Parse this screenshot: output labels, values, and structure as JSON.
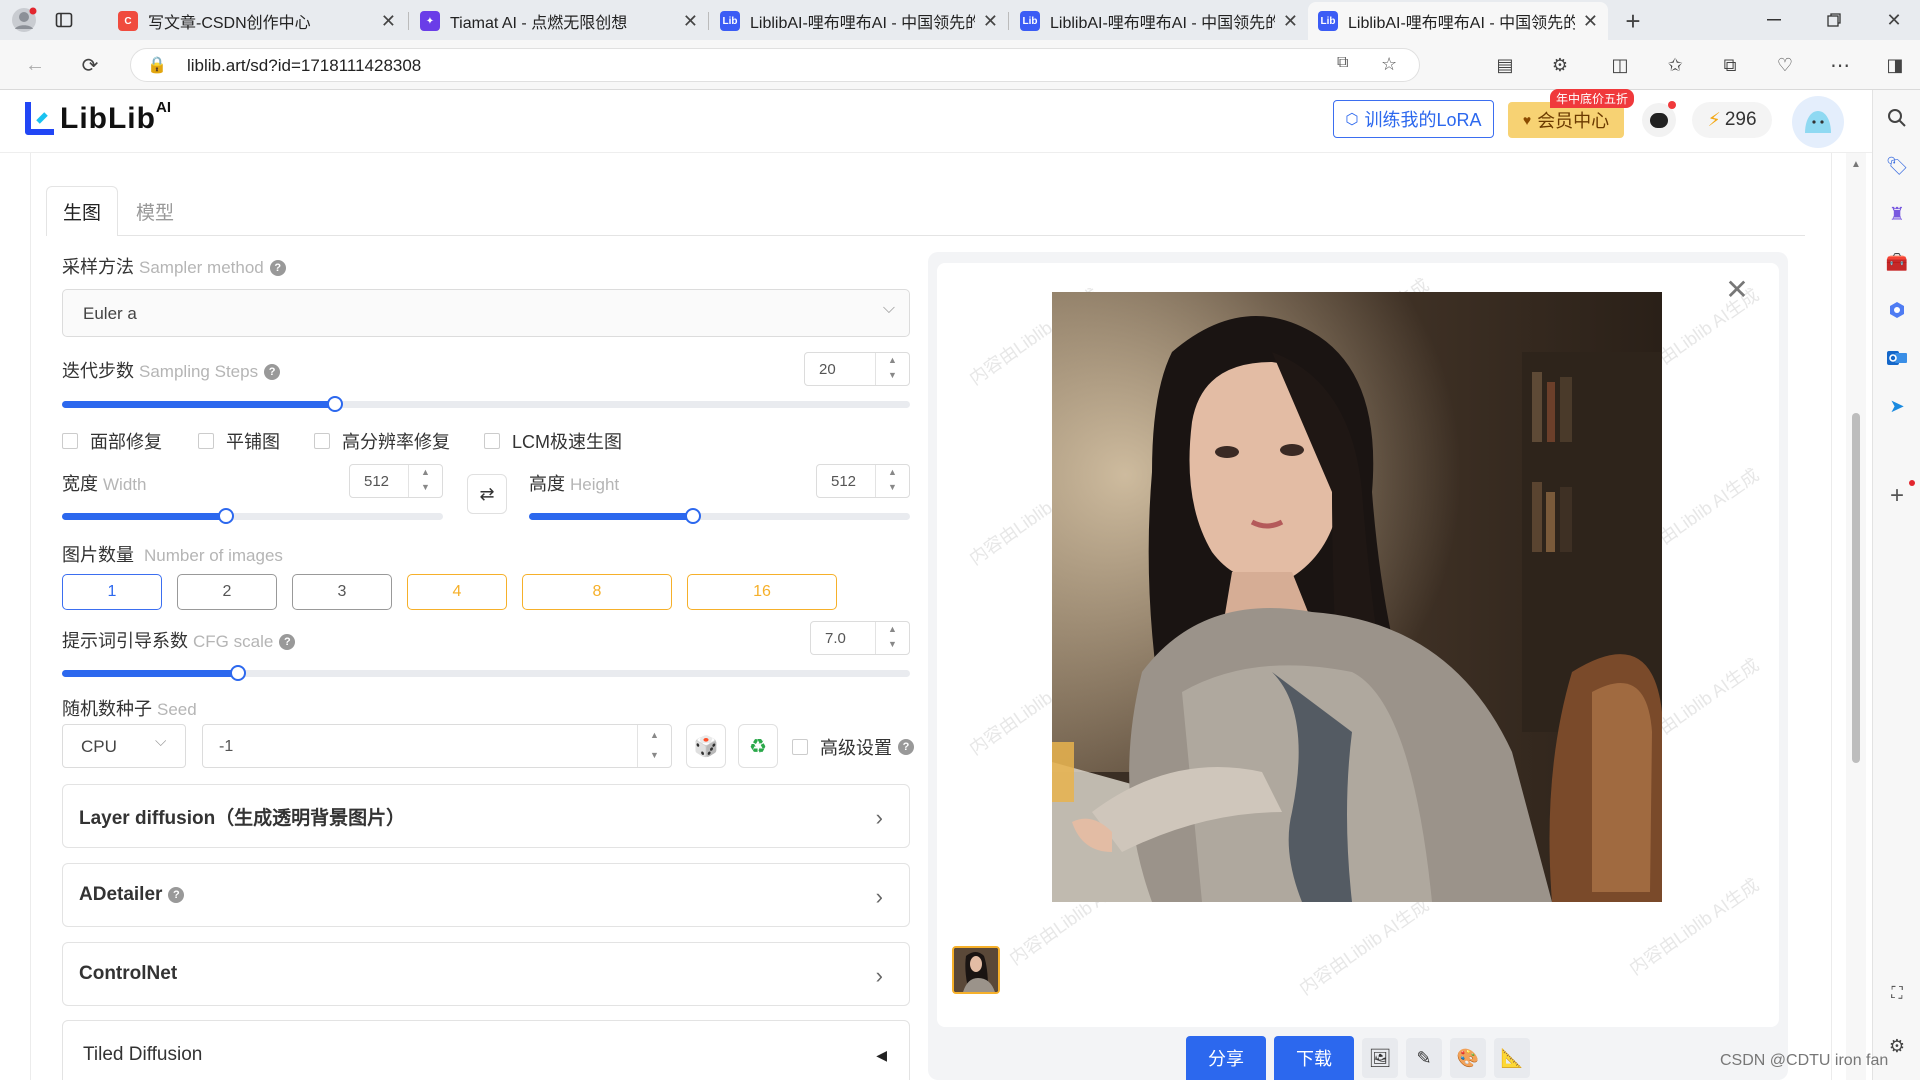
{
  "browser": {
    "tabs": [
      {
        "title": "写文章-CSDN创作中心",
        "favicon_text": "C",
        "favicon_color": "#f04b3e"
      },
      {
        "title": "Tiamat AI - 点燃无限创想",
        "favicon_text": "✦",
        "favicon_color": "#6a3de8"
      },
      {
        "title": "LiblibAI-哩布哩布AI - 中国领先的",
        "favicon_text": "Lib",
        "favicon_color": "#3b5cf5"
      },
      {
        "title": "LiblibAI-哩布哩布AI - 中国领先的",
        "favicon_text": "Lib",
        "favicon_color": "#3b5cf5"
      },
      {
        "title": "LiblibAI-哩布哩布AI - 中国领先的",
        "favicon_text": "Lib",
        "favicon_color": "#3b5cf5"
      }
    ],
    "url": "liblib.art/sd?id=1718111428308"
  },
  "header": {
    "logo": "LibLib",
    "logo_sup": "AI",
    "train_lora": "训练我的LoRA",
    "vip_label": "会员中心",
    "vip_badge": "年中底价五折",
    "points": "296"
  },
  "tabs": {
    "generate": "生图",
    "model": "模型"
  },
  "sampler": {
    "label": "采样方法",
    "label_en": "Sampler method",
    "value": "Euler a"
  },
  "steps": {
    "label": "迭代步数",
    "label_en": "Sampling Steps",
    "value": "20",
    "fraction": 0.322
  },
  "options": [
    "面部修复",
    "平铺图",
    "高分辨率修复",
    "LCM极速生图"
  ],
  "width": {
    "label": "宽度",
    "label_en": "Width",
    "value": "512",
    "fraction": 0.43
  },
  "height": {
    "label": "高度",
    "label_en": "Height",
    "value": "512",
    "fraction": 0.43
  },
  "images": {
    "label": "图片数量",
    "label_en": "Number of images",
    "counts": [
      "1",
      "2",
      "3",
      "4",
      "8",
      "16"
    ],
    "selected": "1"
  },
  "cfg": {
    "label": "提示词引导系数",
    "label_en": "CFG scale",
    "value": "7.0",
    "fraction": 0.208
  },
  "seed": {
    "label": "随机数种子",
    "label_en": "Seed",
    "device": "CPU",
    "value": "-1",
    "advanced": "高级设置"
  },
  "panels": {
    "layer": "Layer diffusion（生成透明背景图片）",
    "adetailer": "ADetailer",
    "controlnet": "ControlNet",
    "tiled": "Tiled Diffusion"
  },
  "preview": {
    "watermark": "内容由Liblib AI生成",
    "share": "分享",
    "download": "下载"
  },
  "footer_credit": "CSDN @CDTU iron fan",
  "colors": {
    "accent": "#2c68ee",
    "orange": "#f6b02a",
    "vip_gold": "#f7d273"
  }
}
